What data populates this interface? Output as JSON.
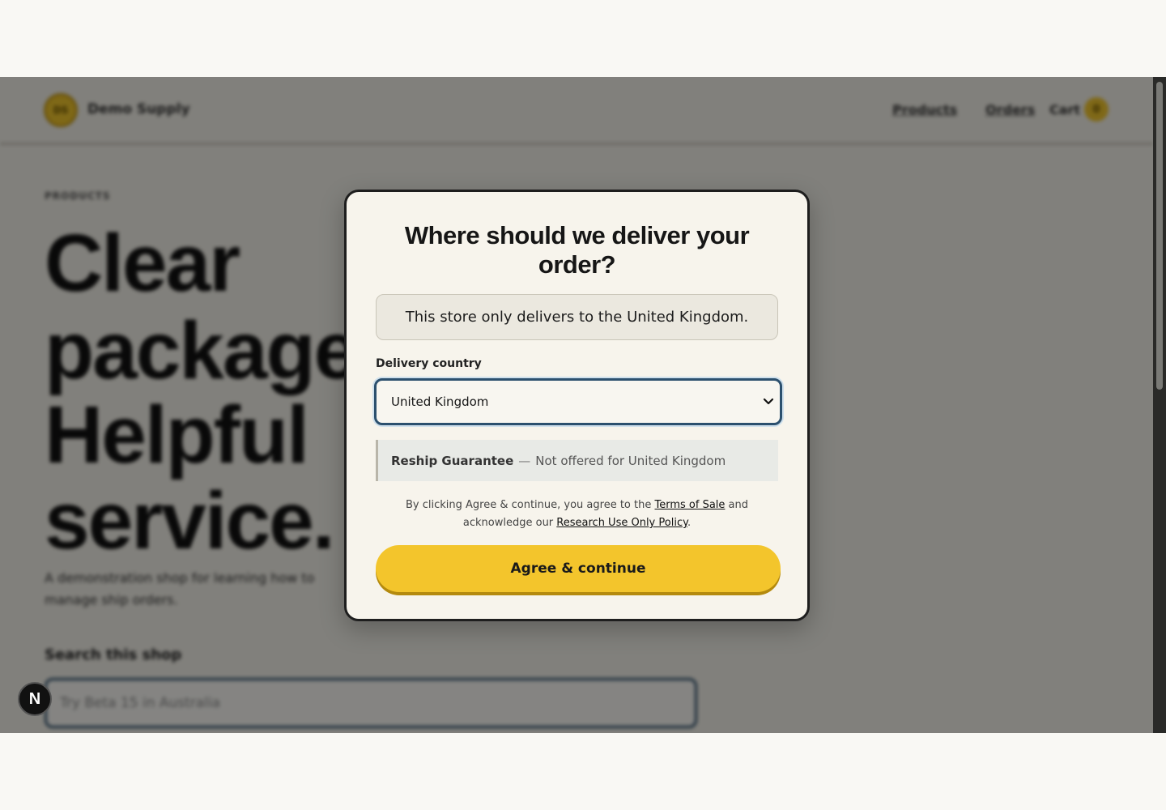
{
  "header": {
    "logo_text": "DS",
    "brand": "Demo Supply",
    "nav": {
      "products": "Products",
      "orders": "Orders",
      "cart": "Cart",
      "cart_count": "0"
    }
  },
  "hero": {
    "eyebrow": "PRODUCTS",
    "headline_lines": [
      "Clear",
      "packages.",
      "Helpful",
      "service."
    ],
    "subtitle": "A demonstration shop for learning how to manage ship orders."
  },
  "search": {
    "label": "Search this shop",
    "placeholder": "Try Beta 15 in Australia"
  },
  "modal": {
    "title": "Where should we deliver your order?",
    "notice": "This store only delivers to the United Kingdom.",
    "field_label": "Delivery country",
    "selected_country": "United Kingdom",
    "reship_name": "Reship Guarantee",
    "reship_dash": "—",
    "reship_status": "Not offered for United Kingdom",
    "legal": {
      "prefix": "By clicking Agree & continue, you agree to the",
      "terms_link": "Terms of Sale",
      "middle": "and acknowledge our",
      "policy_link": "Research Use Only Policy",
      "suffix": "."
    },
    "agree_button": "Agree & continue"
  },
  "dev_badge": "N",
  "colors": {
    "accent": "#f3c52c",
    "focus_ring": "#2c506e",
    "overlay": "rgba(0,0,0,0.47)"
  }
}
